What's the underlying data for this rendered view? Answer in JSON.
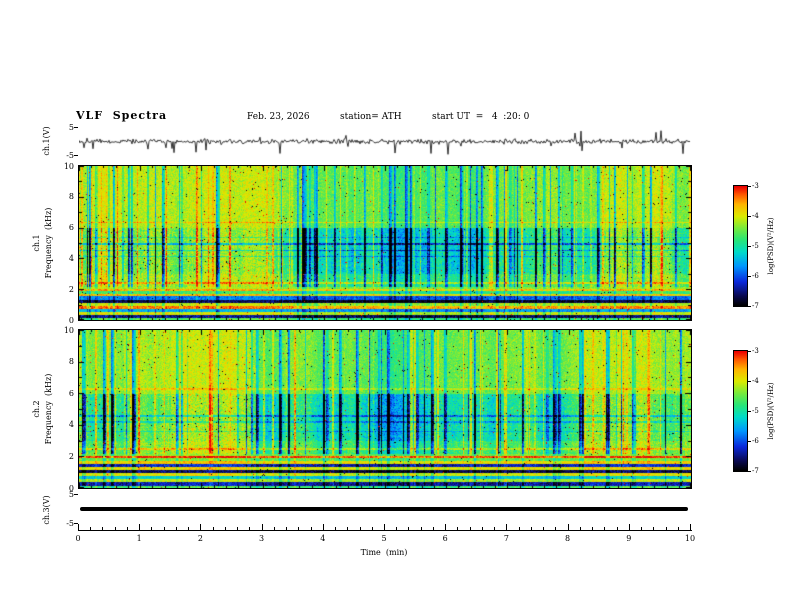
{
  "header": {
    "title": "VLF  Spectra",
    "date": "Feb. 23, 2026",
    "station": "station= ATH",
    "start_ut": "start UT  =   4  :20: 0"
  },
  "panels": {
    "ch1_wave": {
      "label": "ch.1(V)",
      "ymax": "5",
      "ymin": "-5"
    },
    "spec1": {
      "label_line1": "ch.1",
      "label_line2": "Frequency  (kHz)"
    },
    "spec2": {
      "label_line1": "ch.2",
      "label_line2": "Frequency  (kHz)"
    },
    "ch3_wave": {
      "label": "ch.3(V)",
      "ymax": "5",
      "ymin": "-5"
    }
  },
  "axes": {
    "x": {
      "ticks": [
        "0",
        "1",
        "2",
        "3",
        "4",
        "5",
        "6",
        "7",
        "8",
        "9",
        "10"
      ],
      "label": "Time  (min)"
    },
    "spec_y": {
      "ticks": [
        "10",
        "8",
        "6",
        "4",
        "2",
        "0"
      ]
    },
    "colorbar": {
      "ticks": [
        "-3",
        "-4",
        "-5",
        "-6",
        "-7"
      ],
      "label": "log(PSD)(V²/Hz)"
    }
  },
  "colormap": {
    "range": [
      -7,
      -3
    ],
    "stops": [
      [
        0.0,
        0,
        0,
        0
      ],
      [
        0.08,
        10,
        10,
        80
      ],
      [
        0.2,
        10,
        40,
        220
      ],
      [
        0.33,
        0,
        150,
        255
      ],
      [
        0.45,
        0,
        220,
        200
      ],
      [
        0.55,
        40,
        230,
        120
      ],
      [
        0.65,
        120,
        235,
        60
      ],
      [
        0.75,
        220,
        235,
        0
      ],
      [
        0.85,
        255,
        180,
        0
      ],
      [
        0.93,
        255,
        90,
        0
      ],
      [
        1.0,
        235,
        0,
        0
      ]
    ]
  },
  "chart_data": [
    {
      "type": "line",
      "panel": "ch1-voltage",
      "ylabel": "ch.1(V)",
      "xlabel": "Time (min)",
      "xlim": [
        0,
        10
      ],
      "ylim": [
        -5,
        5
      ],
      "description": "Broadband noise trace fluctuating near 0 V with frequent impulsive sferic spikes reaching about -5 to +4 V over the 10-minute record",
      "gen": {
        "seed": 42,
        "noise_amp": 0.8,
        "spike_down_rate": 0.035,
        "spike_up_rate": 0.022,
        "spike_down_max": 4.8,
        "spike_up_max": 4.0
      }
    },
    {
      "type": "heatmap",
      "panel": "ch1-spectrogram",
      "ylabel": "ch.1 Frequency (kHz)",
      "xlim": [
        0,
        10
      ],
      "ylim": [
        0,
        10
      ],
      "zlabel": "log(PSD)(V²/Hz)",
      "zlim": [
        -7,
        -3
      ],
      "description": "VLF spectrogram: green/yellow background near -4.5 with dense dark-blue vertical streaks between ~2.5-6 kHz, brighter yellow-green above 6 kHz, red speckles, and strong horizontal banding below ~2.2 kHz including near-black gaps and red/orange narrowband lines",
      "gen": {
        "seed": 7,
        "bands": [
          {
            "lo": 2.04,
            "hi": 2.2,
            "v": -4.3
          },
          {
            "lo": 1.9,
            "hi": 2.04,
            "v": -3.7
          },
          {
            "lo": 1.74,
            "hi": 1.9,
            "v": -4.8
          },
          {
            "lo": 1.56,
            "hi": 1.74,
            "v": -3.8
          },
          {
            "lo": 1.3,
            "hi": 1.56,
            "v": -5.9
          },
          {
            "lo": 1.12,
            "hi": 1.3,
            "v": -6.8
          },
          {
            "lo": 0.94,
            "hi": 1.12,
            "v": -4.2
          },
          {
            "lo": 0.76,
            "hi": 0.94,
            "v": -3.5
          },
          {
            "lo": 0.56,
            "hi": 0.76,
            "v": -5.6
          },
          {
            "lo": 0.36,
            "hi": 0.56,
            "v": -4.1
          },
          {
            "lo": 0.16,
            "hi": 0.36,
            "v": -6.6
          },
          {
            "lo": 0.0,
            "hi": 0.16,
            "v": -4.7
          }
        ],
        "hlines": [
          {
            "f": 4.95,
            "w": 0.06,
            "d": -1.1
          },
          {
            "f": 4.55,
            "w": 0.05,
            "d": -0.8
          },
          {
            "f": 4.15,
            "w": 0.05,
            "d": -0.6
          },
          {
            "f": 5.4,
            "w": 0.04,
            "d": -0.5
          },
          {
            "f": 2.45,
            "w": 0.07,
            "d": 0.7
          },
          {
            "f": 6.35,
            "w": 0.05,
            "d": 0.5
          }
        ]
      }
    },
    {
      "type": "heatmap",
      "panel": "ch2-spectrogram",
      "ylabel": "ch.2 Frequency (kHz)",
      "xlim": [
        0,
        10
      ],
      "ylim": [
        0,
        10
      ],
      "zlabel": "log(PSD)(V²/Hz)",
      "zlim": [
        -7,
        -3
      ],
      "description": "Similar VLF spectrogram to ch.1 with a prominent red narrowband line near 2 kHz, alternating bright/dark horizontal bands below 2.2 kHz, and blue vertical impulsive streaks between ~2.5-6 kHz",
      "gen": {
        "seed": 19,
        "bands": [
          {
            "lo": 2.05,
            "hi": 2.2,
            "v": -4.4
          },
          {
            "lo": 1.95,
            "hi": 2.05,
            "v": -3.2
          },
          {
            "lo": 1.75,
            "hi": 1.95,
            "v": -4.5
          },
          {
            "lo": 1.55,
            "hi": 1.75,
            "v": -3.8
          },
          {
            "lo": 1.38,
            "hi": 1.55,
            "v": -6.3
          },
          {
            "lo": 1.18,
            "hi": 1.38,
            "v": -3.9
          },
          {
            "lo": 0.98,
            "hi": 1.18,
            "v": -6.7
          },
          {
            "lo": 0.78,
            "hi": 0.98,
            "v": -4.0
          },
          {
            "lo": 0.58,
            "hi": 0.78,
            "v": -5.3
          },
          {
            "lo": 0.38,
            "hi": 0.58,
            "v": -4.2
          },
          {
            "lo": 0.18,
            "hi": 0.38,
            "v": -6.4
          },
          {
            "lo": 0.0,
            "hi": 0.18,
            "v": -4.7
          }
        ],
        "hlines": [
          {
            "f": 4.6,
            "w": 0.05,
            "d": -0.8
          },
          {
            "f": 4.2,
            "w": 0.05,
            "d": -0.6
          },
          {
            "f": 3.6,
            "w": 0.05,
            "d": -0.5
          },
          {
            "f": 2.5,
            "w": 0.06,
            "d": 0.6
          },
          {
            "f": 6.3,
            "w": 0.05,
            "d": 0.4
          }
        ]
      }
    },
    {
      "type": "line",
      "panel": "ch3-voltage",
      "ylabel": "ch.3(V)",
      "xlim": [
        0,
        10
      ],
      "ylim": [
        -5,
        5
      ],
      "description": "Constant flat thick black line slightly below 0 V (channel carries no signal)",
      "value": -0.3
    }
  ]
}
